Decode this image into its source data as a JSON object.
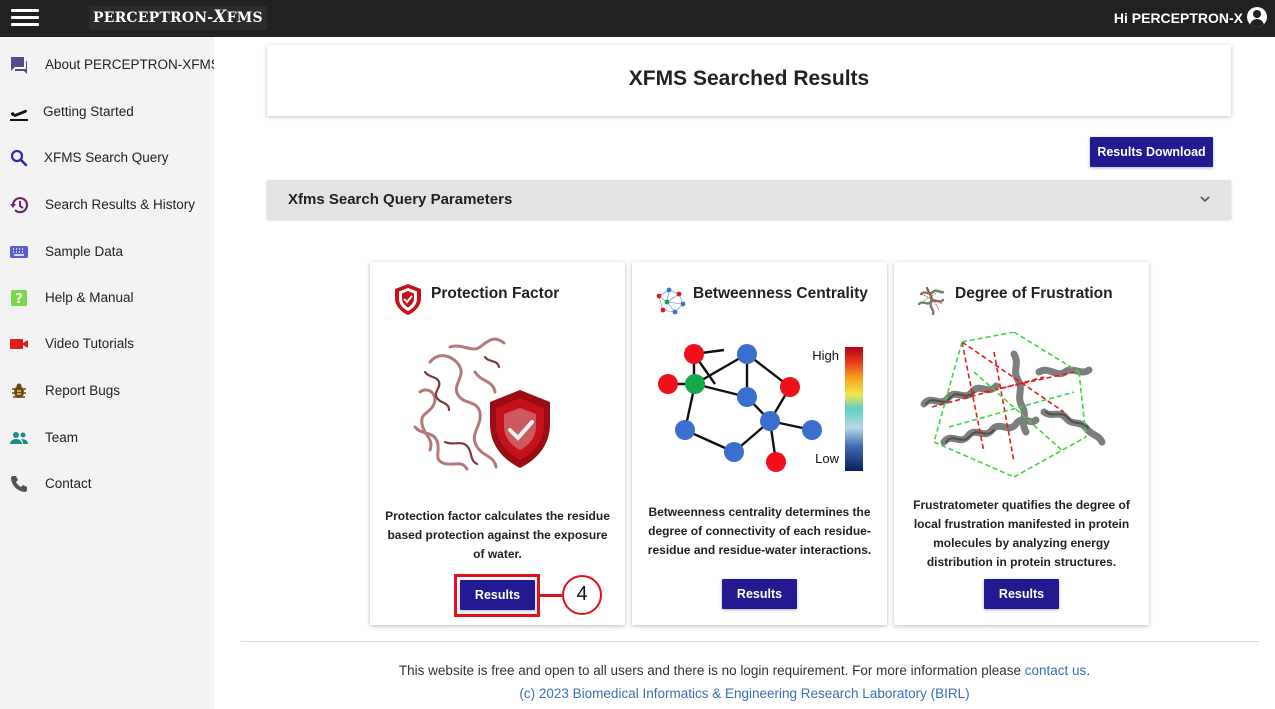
{
  "header": {
    "brand_main": "PERCEPTRON",
    "brand_sep": "-",
    "brand_x": "X",
    "brand_suffix": "FMS",
    "greeting": "Hi PERCEPTRON-X"
  },
  "sidebar": {
    "items": [
      {
        "label": "About PERCEPTRON-XFMS",
        "icon": "chat-icon",
        "color": "#5b4a8a"
      },
      {
        "label": "Getting Started",
        "icon": "takeoff-icon",
        "color": "#111111"
      },
      {
        "label": "XFMS Search Query",
        "icon": "search-icon",
        "color": "#2a2aa8"
      },
      {
        "label": "Search Results & History",
        "icon": "history-icon",
        "color": "#6a2a6a"
      },
      {
        "label": "Sample Data",
        "icon": "keyboard-icon",
        "color": "#5b5bd8"
      },
      {
        "label": "Help & Manual",
        "icon": "help-icon",
        "color": "#7bd84a"
      },
      {
        "label": "Video Tutorials",
        "icon": "video-icon",
        "color": "#e21b1b"
      },
      {
        "label": "Report Bugs",
        "icon": "bug-icon",
        "color": "#6a4a10"
      },
      {
        "label": "Team",
        "icon": "team-icon",
        "color": "#1a8a8a"
      },
      {
        "label": "Contact",
        "icon": "phone-icon",
        "color": "#555555"
      }
    ]
  },
  "main": {
    "title": "XFMS Searched Results",
    "download_label": "Results Download",
    "accordion_label": "Xfms Search Query Parameters",
    "cards": [
      {
        "title": "Protection Factor",
        "icon": "shield-icon",
        "description": "Protection factor calculates the residue based protection against the exposure of water.",
        "button": "Results"
      },
      {
        "title": "Betweenness Centrality",
        "icon": "network-icon",
        "description": "Betweenness centrality determines the degree of connectivity of each residue-residue and residue-water interactions.",
        "button": "Results",
        "legend_high": "High",
        "legend_low": "Low"
      },
      {
        "title": "Degree of Frustration",
        "icon": "protein-icon",
        "description": "Frustratometer quatifies the degree of local frustration manifested in protein molecules by analyzing energy distribution in protein structures.",
        "button": "Results"
      }
    ],
    "callout_number": "4"
  },
  "footer": {
    "text": "This website is free and open to all users and there is no login requirement. For more information please",
    "link": "contact us",
    "end": ".",
    "copyright": "(c) 2023 Biomedical Informatics & Engineering Research Laboratory (BIRL)"
  },
  "colors": {
    "topbar": "#212121",
    "accent_button": "#231991",
    "highlight": "#e0101c",
    "link": "#3a6fb5"
  }
}
